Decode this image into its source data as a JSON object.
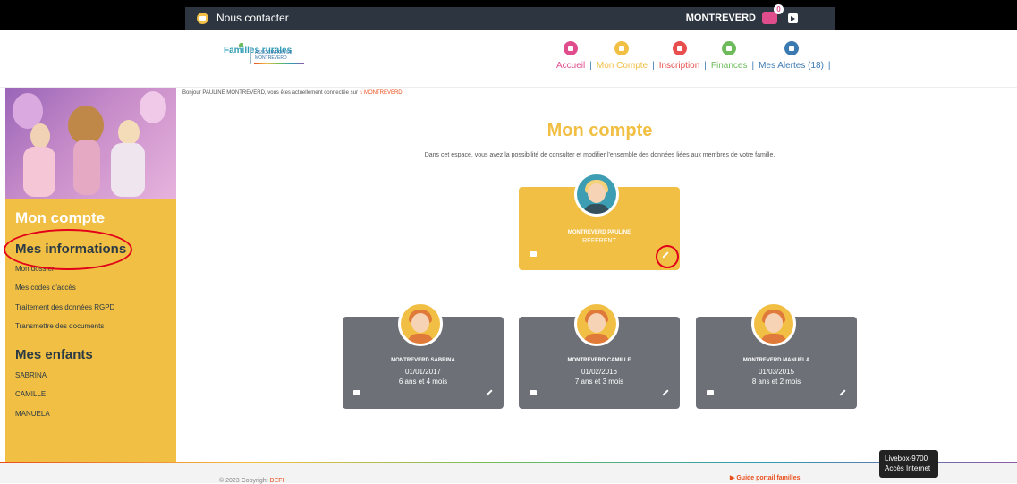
{
  "topbar": {
    "contact_label": "Nous contacter",
    "user_label": "MONTREVERD",
    "notification_count": "0"
  },
  "header": {
    "logo_main": "Familles rurales",
    "logo_sub": "ASSOCIATION DE MONTREVERD",
    "nav": [
      {
        "label": "Accueil",
        "color": "#e04d8c"
      },
      {
        "label": "Mon Compte",
        "color": "#f1bf43"
      },
      {
        "label": "Inscription",
        "color": "#e94e4e"
      },
      {
        "label": "Finances",
        "color": "#6dbb5b"
      },
      {
        "label": "Mes Alertes (18)",
        "color": "#3b7ab1"
      }
    ]
  },
  "sidebar": {
    "title": "Mon compte",
    "sections": [
      {
        "title": "Mes informations",
        "items": [
          "Mon dossier",
          "Mes codes d'accès",
          "Traitement des données RGPD",
          "Transmettre des documents"
        ]
      },
      {
        "title": "Mes enfants",
        "items": [
          "SABRINA",
          "CAMILLE",
          "MANUELA"
        ]
      }
    ]
  },
  "greeting": {
    "prefix": "Bonjour PAULINE MONTREVERD, vous êtes actuellement connectée sur",
    "site": "MONTREVERD"
  },
  "main": {
    "title": "Mon compte",
    "description": "Dans cet espace, vous avez la possibilité de consulter et modifier l'ensemble des données liées aux membres de votre famille."
  },
  "referent": {
    "name": "MONTREVERD PAULINE",
    "role": "RÉFÉRENT"
  },
  "children": [
    {
      "name": "MONTREVERD SABRINA",
      "birth": "01/01/2017",
      "age": "6 ans et 4 mois"
    },
    {
      "name": "MONTREVERD CAMILLE",
      "birth": "01/02/2016",
      "age": "7 ans et 3 mois"
    },
    {
      "name": "MONTREVERD MANUELA",
      "birth": "01/03/2015",
      "age": "8 ans et 2 mois"
    }
  ],
  "footer": {
    "copyright": "© 2023 Copyright",
    "copyright_link": "DEFI",
    "guide": "Guide portail familles"
  },
  "tooltip": {
    "line1": "Livebox-9700",
    "line2": "Accès Internet"
  }
}
